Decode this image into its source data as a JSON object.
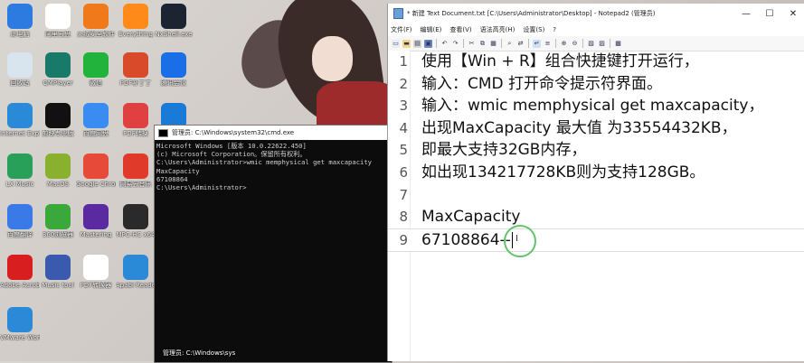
{
  "desktop": {
    "icons": [
      {
        "label": "此电脑",
        "icon": "computer-icon",
        "color": "#2d7be0"
      },
      {
        "label": "阿里云盘",
        "icon": "cloud-icon",
        "color": "#ffffff"
      },
      {
        "label": "火绒安全软件",
        "icon": "shield-icon",
        "color": "#f07a1a"
      },
      {
        "label": "Everything",
        "icon": "magnifier-icon",
        "color": "#ff8a1a"
      },
      {
        "label": "NxShell.exe",
        "icon": "terminal-icon",
        "color": "#1b2430"
      },
      {
        "label": "回收站",
        "icon": "recycle-bin-icon",
        "color": "#d8e4ee"
      },
      {
        "label": "QMPlayer",
        "icon": "play-icon",
        "color": "#1a7a6a"
      },
      {
        "label": "微信",
        "icon": "wechat-icon",
        "color": "#21b33b"
      },
      {
        "label": "PDF补丁丁",
        "icon": "stamp-icon",
        "color": "#d94a2a"
      },
      {
        "label": "腾讯会议",
        "icon": "meeting-icon",
        "color": "#1a6ee8"
      },
      {
        "label": "Internet Explorer",
        "icon": "ie-icon",
        "color": "#2a8ad8"
      },
      {
        "label": "剪映专业版",
        "icon": "capcut-icon",
        "color": "#111111"
      },
      {
        "label": "百度网盘",
        "icon": "disk-icon",
        "color": "#3a8cf0"
      },
      {
        "label": "PDF转换",
        "icon": "pdf-icon",
        "color": "#e04040"
      },
      {
        "label": "Opencv",
        "icon": "gear-icon",
        "color": "#1a7ad8"
      },
      {
        "label": "LX Music",
        "icon": "music-icon",
        "color": "#29a05a"
      },
      {
        "label": "MacOS",
        "icon": "disc-icon",
        "color": "#8ab030"
      },
      {
        "label": "Google Chrome",
        "icon": "chrome-icon",
        "color": "#e84a3a"
      },
      {
        "label": "网易云音乐",
        "icon": "netease-icon",
        "color": "#e03a2a"
      },
      {
        "label": "中国移动",
        "icon": "media-icon",
        "color": "#2a88e0"
      },
      {
        "label": "百度翻译",
        "icon": "translate-icon",
        "color": "#3a7ae8"
      },
      {
        "label": "360浏览器",
        "icon": "browser-icon",
        "color": "#3aa83a"
      },
      {
        "label": "Mastering",
        "icon": "audio-icon",
        "color": "#5a2aa0"
      },
      {
        "label": "MPC-HC x64",
        "icon": "clapper-icon",
        "color": "#2a2a2a"
      },
      {
        "label": "QQ",
        "icon": "qq-icon",
        "color": "#ffffff"
      },
      {
        "label": "Adobe Acrobat",
        "icon": "acrobat-icon",
        "color": "#d81e1e"
      },
      {
        "label": "Music tool",
        "icon": "player-icon",
        "color": "#3a5ab0"
      },
      {
        "label": "PDF转换器",
        "icon": "pdf-convert-icon",
        "color": "#ffffff"
      },
      {
        "label": "Apabi Reader",
        "icon": "reader-icon",
        "color": "#2a8ad8"
      },
      {
        "label": "驱动管理",
        "icon": "trash-icon",
        "color": "#c0c8d0"
      },
      {
        "label": "VMware Workstation",
        "icon": "vmware-icon",
        "color": "#2a8ad8"
      }
    ],
    "taskbar_text": "管理员: C:\\Windows\\sys"
  },
  "cmd": {
    "title": "管理员: C:\\Windows\\system32\\cmd.exe",
    "lines": [
      "Microsoft Windows [版本 10.0.22622.450]",
      "(c) Microsoft Corporation。保留所有权利。",
      "",
      "C:\\Users\\Administrator>wmic memphysical get maxcapacity",
      "MaxCapacity",
      "67108864",
      "",
      "C:\\Users\\Administrator>"
    ]
  },
  "notepad": {
    "title": "* 新建 Text Document.txt [C:\\Users\\Administrator\\Desktop] - Notepad2 (管理员)",
    "minimize": "—",
    "maximize": "☐",
    "close": "✕",
    "menu": [
      "文件(F)",
      "编辑(E)",
      "查看(V)",
      "语法高亮(H)",
      "设置(S)",
      "?"
    ],
    "lines": [
      {
        "num": "1",
        "text": "使用【Win + R】组合快捷键打开运行，"
      },
      {
        "num": "2",
        "text": "输入：CMD 打开命令提示符界面。"
      },
      {
        "num": "3",
        "text": "输入：wmic memphysical get maxcapacity，"
      },
      {
        "num": "4",
        "text": "出现MaxCapacity 最大值 为33554432KB，"
      },
      {
        "num": "5",
        "text": "即最大支持32GB内存，"
      },
      {
        "num": "6",
        "text": "如出现134217728KB则为支持128GB。"
      },
      {
        "num": "7",
        "text": ""
      },
      {
        "num": "8",
        "text": "MaxCapacity"
      },
      {
        "num": "9",
        "text": "67108864--"
      }
    ]
  }
}
